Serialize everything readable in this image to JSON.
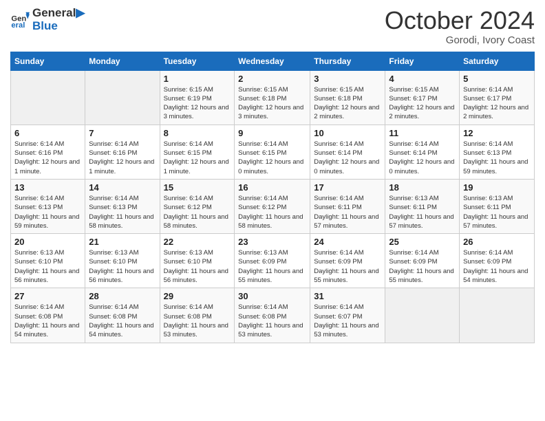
{
  "logo": {
    "line1": "General",
    "line2": "Blue"
  },
  "title": "October 2024",
  "subtitle": "Gorodi, Ivory Coast",
  "days_of_week": [
    "Sunday",
    "Monday",
    "Tuesday",
    "Wednesday",
    "Thursday",
    "Friday",
    "Saturday"
  ],
  "weeks": [
    [
      {
        "day": "",
        "info": ""
      },
      {
        "day": "",
        "info": ""
      },
      {
        "day": "1",
        "info": "Sunrise: 6:15 AM\nSunset: 6:19 PM\nDaylight: 12 hours and 3 minutes."
      },
      {
        "day": "2",
        "info": "Sunrise: 6:15 AM\nSunset: 6:18 PM\nDaylight: 12 hours and 3 minutes."
      },
      {
        "day": "3",
        "info": "Sunrise: 6:15 AM\nSunset: 6:18 PM\nDaylight: 12 hours and 2 minutes."
      },
      {
        "day": "4",
        "info": "Sunrise: 6:15 AM\nSunset: 6:17 PM\nDaylight: 12 hours and 2 minutes."
      },
      {
        "day": "5",
        "info": "Sunrise: 6:14 AM\nSunset: 6:17 PM\nDaylight: 12 hours and 2 minutes."
      }
    ],
    [
      {
        "day": "6",
        "info": "Sunrise: 6:14 AM\nSunset: 6:16 PM\nDaylight: 12 hours and 1 minute."
      },
      {
        "day": "7",
        "info": "Sunrise: 6:14 AM\nSunset: 6:16 PM\nDaylight: 12 hours and 1 minute."
      },
      {
        "day": "8",
        "info": "Sunrise: 6:14 AM\nSunset: 6:15 PM\nDaylight: 12 hours and 1 minute."
      },
      {
        "day": "9",
        "info": "Sunrise: 6:14 AM\nSunset: 6:15 PM\nDaylight: 12 hours and 0 minutes."
      },
      {
        "day": "10",
        "info": "Sunrise: 6:14 AM\nSunset: 6:14 PM\nDaylight: 12 hours and 0 minutes."
      },
      {
        "day": "11",
        "info": "Sunrise: 6:14 AM\nSunset: 6:14 PM\nDaylight: 12 hours and 0 minutes."
      },
      {
        "day": "12",
        "info": "Sunrise: 6:14 AM\nSunset: 6:13 PM\nDaylight: 11 hours and 59 minutes."
      }
    ],
    [
      {
        "day": "13",
        "info": "Sunrise: 6:14 AM\nSunset: 6:13 PM\nDaylight: 11 hours and 59 minutes."
      },
      {
        "day": "14",
        "info": "Sunrise: 6:14 AM\nSunset: 6:13 PM\nDaylight: 11 hours and 58 minutes."
      },
      {
        "day": "15",
        "info": "Sunrise: 6:14 AM\nSunset: 6:12 PM\nDaylight: 11 hours and 58 minutes."
      },
      {
        "day": "16",
        "info": "Sunrise: 6:14 AM\nSunset: 6:12 PM\nDaylight: 11 hours and 58 minutes."
      },
      {
        "day": "17",
        "info": "Sunrise: 6:14 AM\nSunset: 6:11 PM\nDaylight: 11 hours and 57 minutes."
      },
      {
        "day": "18",
        "info": "Sunrise: 6:13 AM\nSunset: 6:11 PM\nDaylight: 11 hours and 57 minutes."
      },
      {
        "day": "19",
        "info": "Sunrise: 6:13 AM\nSunset: 6:11 PM\nDaylight: 11 hours and 57 minutes."
      }
    ],
    [
      {
        "day": "20",
        "info": "Sunrise: 6:13 AM\nSunset: 6:10 PM\nDaylight: 11 hours and 56 minutes."
      },
      {
        "day": "21",
        "info": "Sunrise: 6:13 AM\nSunset: 6:10 PM\nDaylight: 11 hours and 56 minutes."
      },
      {
        "day": "22",
        "info": "Sunrise: 6:13 AM\nSunset: 6:10 PM\nDaylight: 11 hours and 56 minutes."
      },
      {
        "day": "23",
        "info": "Sunrise: 6:13 AM\nSunset: 6:09 PM\nDaylight: 11 hours and 55 minutes."
      },
      {
        "day": "24",
        "info": "Sunrise: 6:14 AM\nSunset: 6:09 PM\nDaylight: 11 hours and 55 minutes."
      },
      {
        "day": "25",
        "info": "Sunrise: 6:14 AM\nSunset: 6:09 PM\nDaylight: 11 hours and 55 minutes."
      },
      {
        "day": "26",
        "info": "Sunrise: 6:14 AM\nSunset: 6:09 PM\nDaylight: 11 hours and 54 minutes."
      }
    ],
    [
      {
        "day": "27",
        "info": "Sunrise: 6:14 AM\nSunset: 6:08 PM\nDaylight: 11 hours and 54 minutes."
      },
      {
        "day": "28",
        "info": "Sunrise: 6:14 AM\nSunset: 6:08 PM\nDaylight: 11 hours and 54 minutes."
      },
      {
        "day": "29",
        "info": "Sunrise: 6:14 AM\nSunset: 6:08 PM\nDaylight: 11 hours and 53 minutes."
      },
      {
        "day": "30",
        "info": "Sunrise: 6:14 AM\nSunset: 6:08 PM\nDaylight: 11 hours and 53 minutes."
      },
      {
        "day": "31",
        "info": "Sunrise: 6:14 AM\nSunset: 6:07 PM\nDaylight: 11 hours and 53 minutes."
      },
      {
        "day": "",
        "info": ""
      },
      {
        "day": "",
        "info": ""
      }
    ]
  ]
}
